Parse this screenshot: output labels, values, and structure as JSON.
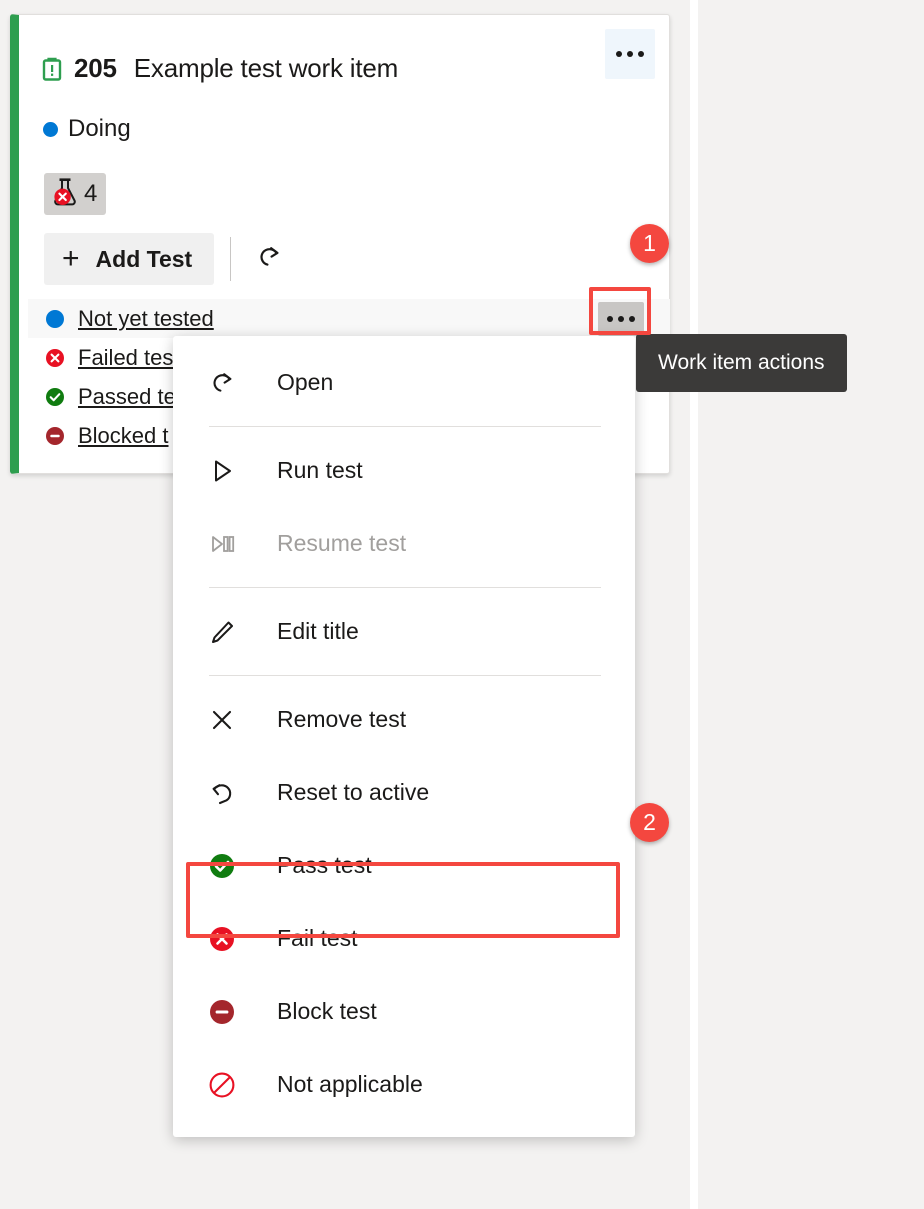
{
  "colors": {
    "accent_blue": "#0078d4",
    "card_border_green": "#2e9e4f",
    "annotation_red": "#f4473f",
    "pass_green": "#107c10",
    "fail_red": "#e81123",
    "block_dark_red": "#a4262c",
    "tooltip_bg": "#3b3a39"
  },
  "card": {
    "work_item_icon": "user-story-icon",
    "id": "205",
    "title": "Example test work item",
    "state_dot_color": "#0078d4",
    "state": "Doing",
    "test_badge": {
      "icon": "beaker-failed-icon",
      "count": "4"
    },
    "toolbar": {
      "add_test_label": "Add Test",
      "add_icon": "plus-icon",
      "refresh_icon": "redo-arrow-icon"
    },
    "ellipsis_icon": "more-actions-icon"
  },
  "test_list": [
    {
      "status_icon": "not-run-icon",
      "status_color": "#0078d4",
      "label": "Not yet tested",
      "hovered": true
    },
    {
      "status_icon": "failed-icon",
      "status_color": "#e81123",
      "label": "Failed tes",
      "hovered": false
    },
    {
      "status_icon": "passed-icon",
      "status_color": "#107c10",
      "label": "Passed te",
      "hovered": false
    },
    {
      "status_icon": "blocked-icon",
      "status_color": "#a4262c",
      "label": "Blocked t",
      "hovered": false
    }
  ],
  "tooltip": {
    "text": "Work item actions"
  },
  "annotations": {
    "badge_1": "1",
    "badge_2": "2"
  },
  "context_menu": {
    "items": [
      {
        "icon": "open-arrow-icon",
        "label": "Open",
        "disabled": false,
        "divider_after": true
      },
      {
        "icon": "play-icon",
        "label": "Run test",
        "disabled": false,
        "divider_after": false
      },
      {
        "icon": "play-pause-icon",
        "label": "Resume test",
        "disabled": true,
        "divider_after": true
      },
      {
        "icon": "pencil-icon",
        "label": "Edit title",
        "disabled": false,
        "divider_after": true
      },
      {
        "icon": "close-x-icon",
        "label": "Remove test",
        "disabled": false,
        "divider_after": false
      },
      {
        "icon": "undo-arrow-icon",
        "label": "Reset to active",
        "disabled": false,
        "divider_after": false
      },
      {
        "icon": "pass-check-icon",
        "label": "Pass test",
        "disabled": false,
        "divider_after": false
      },
      {
        "icon": "fail-x-icon",
        "label": "Fail test",
        "disabled": false,
        "divider_after": false
      },
      {
        "icon": "block-minus-icon",
        "label": "Block test",
        "disabled": false,
        "divider_after": false
      },
      {
        "icon": "not-applicable-icon",
        "label": "Not applicable",
        "disabled": false,
        "divider_after": false
      }
    ]
  }
}
